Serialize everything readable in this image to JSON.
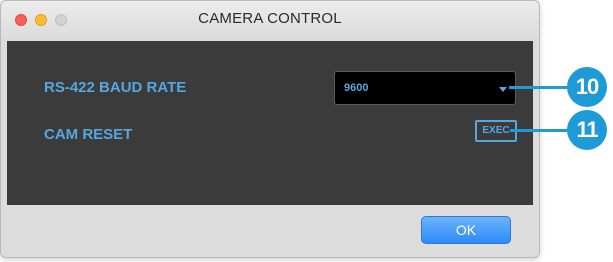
{
  "window": {
    "title": "CAMERA CONTROL"
  },
  "settings": {
    "baud_rate_label": "RS-422 BAUD RATE",
    "baud_rate_value": "9600",
    "cam_reset_label": "CAM RESET",
    "exec_label": "EXEC"
  },
  "footer": {
    "ok_label": "OK"
  },
  "callouts": {
    "baud_rate": "10",
    "cam_reset": "11"
  },
  "colors": {
    "accent": "#56a6df",
    "callout": "#1e9ad6",
    "panel": "#3b3b3b"
  }
}
